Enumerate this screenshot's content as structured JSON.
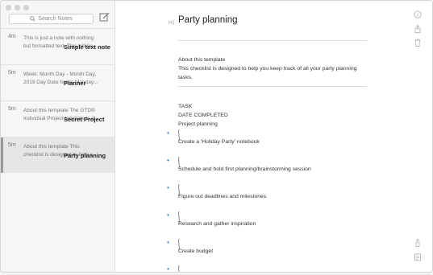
{
  "sidebar": {
    "search_placeholder": "Search Notes",
    "notes": [
      {
        "time": "4m",
        "title": "Simple text note",
        "line1": "This is just a note with nothing",
        "line2": "but formatted text. This will be..."
      },
      {
        "time": "5m",
        "title": "Planner",
        "line1": "Week: Month Day - Month Day,",
        "line2": "2019 Day Date Notes Monday..."
      },
      {
        "time": "5m",
        "title": "Secret Project",
        "line1": "About this template The GTD®",
        "line2": "Individual Project template is d..."
      },
      {
        "time": "5m",
        "title": "Party planning",
        "line1": "About this template This",
        "line2": "checklist is designed to help y..."
      }
    ]
  },
  "editor": {
    "heading_tag": "H1",
    "title": "Party planning",
    "about_heading": "About this template",
    "about_line1": "This checklist is designed to help you keep track of all your party planning",
    "about_line2": "tasks.",
    "table_head1": "TASK",
    "table_head2": "DATE COMPLETED",
    "table_head3": "Project planning",
    "tasks": [
      {
        "box": "[ ]",
        "text": "Create a 'Holiday Party' notebook"
      },
      {
        "box": "[ ]",
        "text": "Schedule and hold first planning/brainstorming session"
      },
      {
        "box": "[ ]",
        "text": "Figure out deadlines and milestones"
      },
      {
        "box": "[ ]",
        "text": "Research and gather inspiration"
      },
      {
        "box": "[ ]",
        "text": "Create budget"
      },
      {
        "box": "[ ]",
        "text": ""
      }
    ]
  },
  "colors": {
    "accent": "#2a7ad6",
    "selected": "#e6e6e6"
  }
}
